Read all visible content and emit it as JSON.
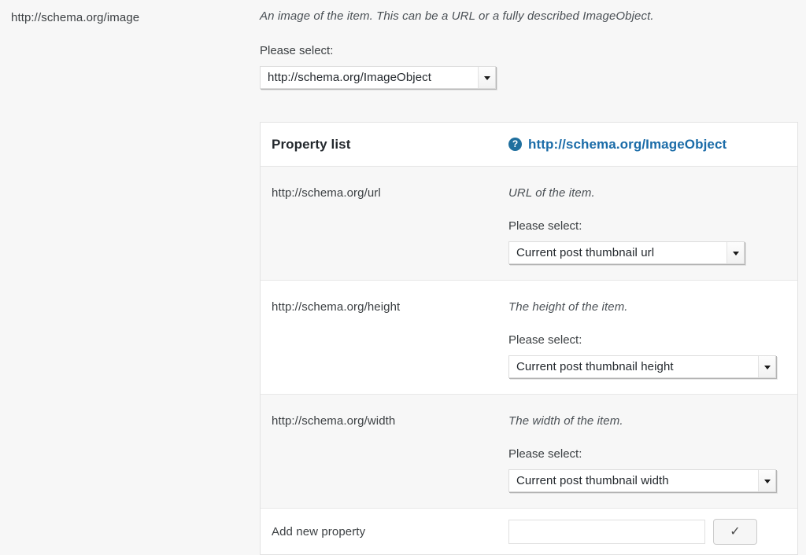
{
  "root_property": {
    "name": "http://schema.org/image",
    "description": "An image of the item. This can be a URL or a fully described ImageObject.",
    "select_label": "Please select:",
    "selected_value": "http://schema.org/ImageObject"
  },
  "table": {
    "header": {
      "title": "Property list",
      "help_icon": "question-mark-circle-icon",
      "type_link": "http://schema.org/ImageObject"
    },
    "rows": [
      {
        "property": "http://schema.org/url",
        "description": "URL of the item.",
        "select_label": "Please select:",
        "selected_value": "Current post thumbnail url"
      },
      {
        "property": "http://schema.org/height",
        "description": "The height of the item.",
        "select_label": "Please select:",
        "selected_value": "Current post thumbnail height"
      },
      {
        "property": "http://schema.org/width",
        "description": "The width of the item.",
        "select_label": "Please select:",
        "selected_value": "Current post thumbnail width"
      }
    ],
    "add_row": {
      "label": "Add new property",
      "input_value": "",
      "input_placeholder": "",
      "confirm_icon": "checkmark-icon",
      "confirm_label": "✓"
    }
  },
  "colors": {
    "page_background": "#f7f7f7",
    "link_blue": "#1b6ca8",
    "help_icon_blue": "#1f6f9e",
    "row_shade": "#f7f7f7",
    "row_plain": "#ffffff"
  }
}
